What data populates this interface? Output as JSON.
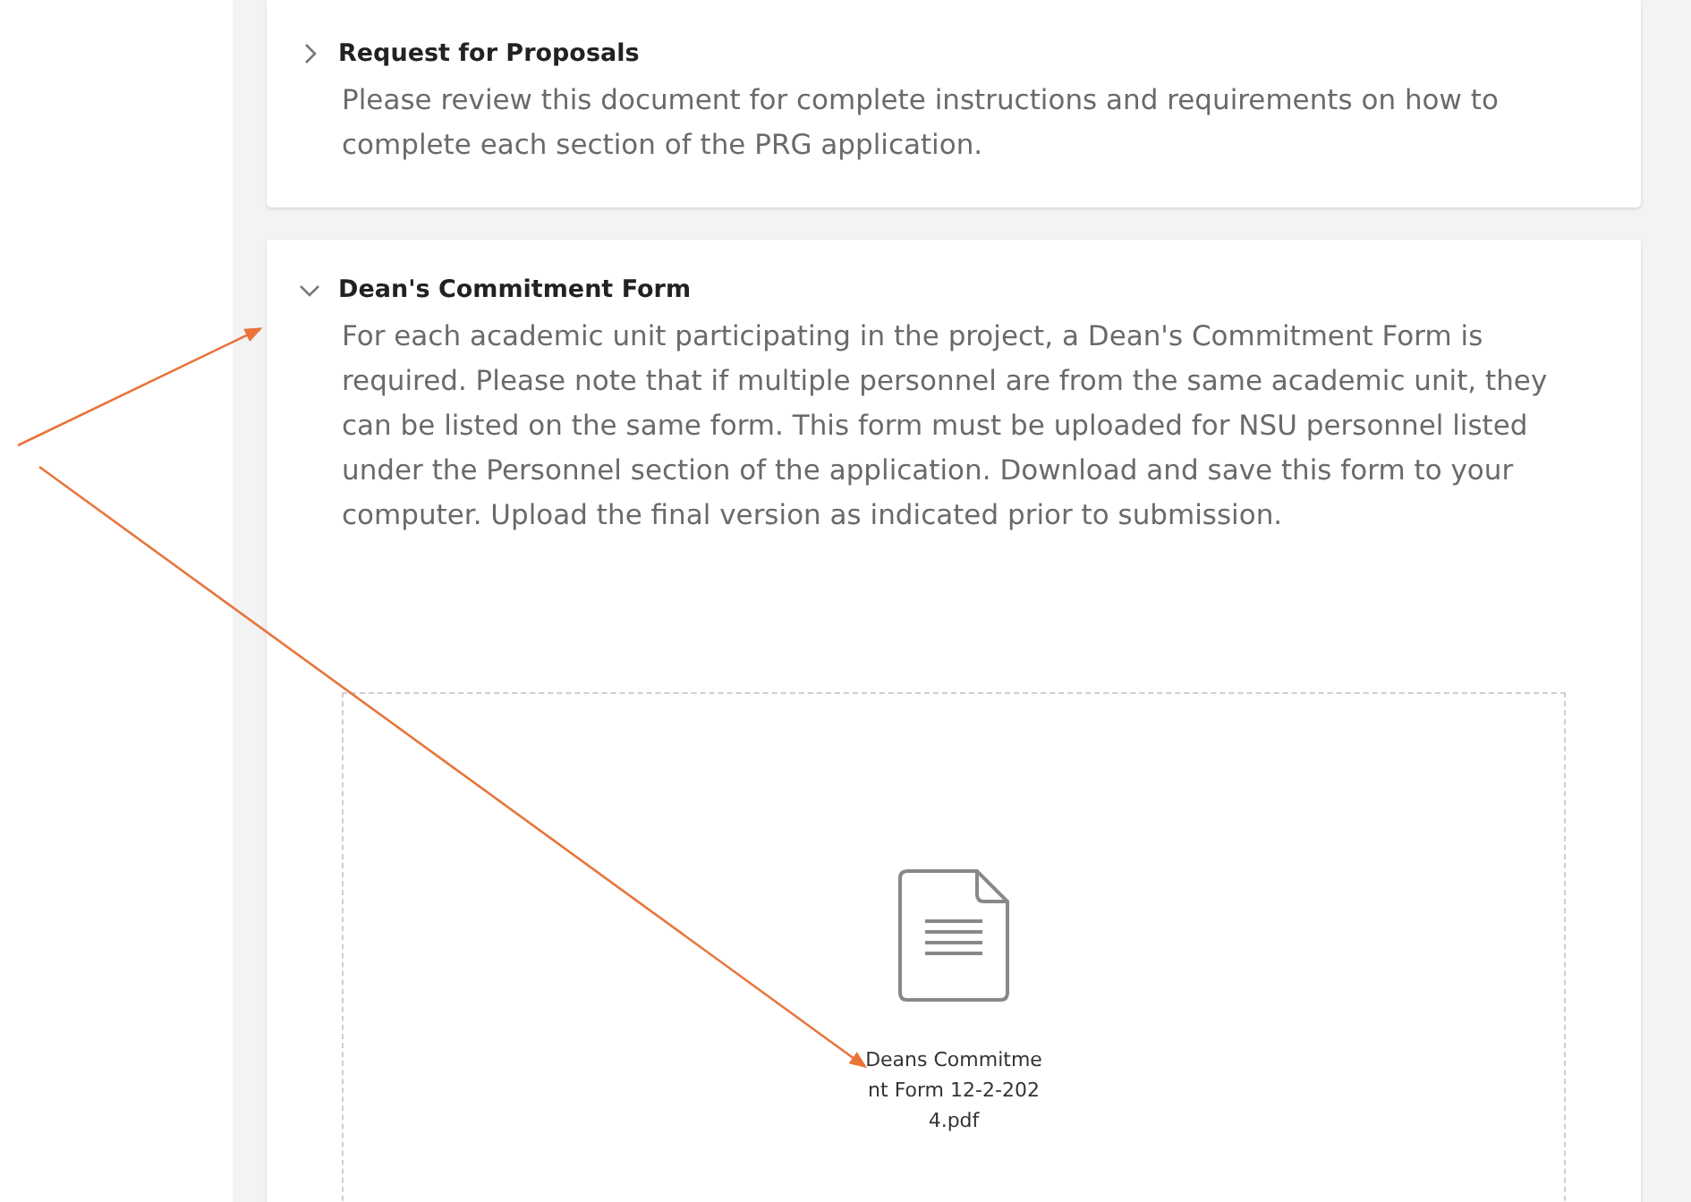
{
  "sections": [
    {
      "title": "Request for Proposals",
      "expanded": false,
      "description": "Please review this document for complete instructions and requirements on how to complete each section of the PRG application."
    },
    {
      "title": "Dean's Commitment Form",
      "expanded": true,
      "description": "For each academic unit participating in the project, a Dean's Commitment Form is required. Please note that if multiple personnel are from the same academic unit, they can be listed on the same form. This form must be uploaded for NSU personnel listed under the Personnel section of the application. Download and save this form to your computer. Upload the final version as indicated prior to submission.",
      "file": {
        "name": "Deans Commitment Form 12-2-2024.pdf"
      }
    }
  ]
}
